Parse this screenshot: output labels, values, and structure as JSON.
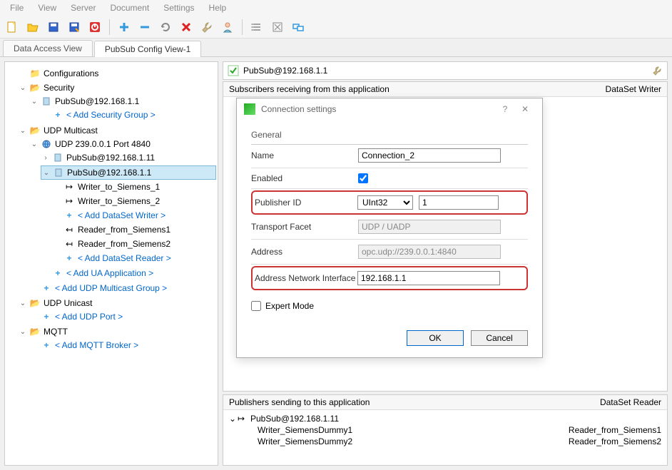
{
  "menu": {
    "file": "File",
    "view": "View",
    "server": "Server",
    "document": "Document",
    "settings": "Settings",
    "help": "Help"
  },
  "tabs": {
    "data_access": "Data Access View",
    "pubsub": "PubSub Config View-1"
  },
  "tree": {
    "configurations": "Configurations",
    "security": "Security",
    "security_pubsub": "PubSub@192.168.1.1",
    "add_security_group": "< Add Security Group >",
    "udp_multicast": "UDP Multicast",
    "udp_group": "UDP 239.0.0.1 Port 4840",
    "pubsub_111": "PubSub@192.168.1.11",
    "pubsub_11": "PubSub@192.168.1.1",
    "writer1": "Writer_to_Siemens_1",
    "writer2": "Writer_to_Siemens_2",
    "add_dataset_writer": "< Add DataSet Writer >",
    "reader1": "Reader_from_Siemens1",
    "reader2": "Reader_from_Siemens2",
    "add_dataset_reader": "< Add DataSet Reader >",
    "add_ua_app": "< Add UA Application >",
    "add_udp_mgroup": "< Add UDP Multicast Group >",
    "udp_unicast": "UDP Unicast",
    "add_udp_port": "< Add UDP Port >",
    "mqtt": "MQTT",
    "add_mqtt_broker": "< Add MQTT Broker >"
  },
  "right_bar": {
    "title": "PubSub@192.168.1.1"
  },
  "subscribers": {
    "heading": "Subscribers receiving from this application",
    "col2": "DataSet Writer"
  },
  "publishers": {
    "heading": "Publishers sending to this application",
    "col2": "DataSet Reader",
    "root": "PubSub@192.168.1.11",
    "rows": [
      {
        "name": "Writer_SiemensDummy1",
        "reader": "Reader_from_Siemens1"
      },
      {
        "name": "Writer_SiemensDummy2",
        "reader": "Reader_from_Siemens2"
      }
    ]
  },
  "dialog": {
    "title": "Connection settings",
    "group": "General",
    "labels": {
      "name": "Name",
      "enabled": "Enabled",
      "publisher_id": "Publisher ID",
      "transport_facet": "Transport Facet",
      "address": "Address",
      "address_iface": "Address Network Interface",
      "expert_mode": "Expert Mode"
    },
    "values": {
      "name": "Connection_2",
      "enabled": true,
      "publisher_id_type": "UInt32",
      "publisher_id": "1",
      "transport_facet": "UDP / UADP",
      "address": "opc.udp://239.0.0.1:4840",
      "address_iface": "192.168.1.1",
      "expert_mode": false
    },
    "buttons": {
      "ok": "OK",
      "cancel": "Cancel"
    }
  }
}
